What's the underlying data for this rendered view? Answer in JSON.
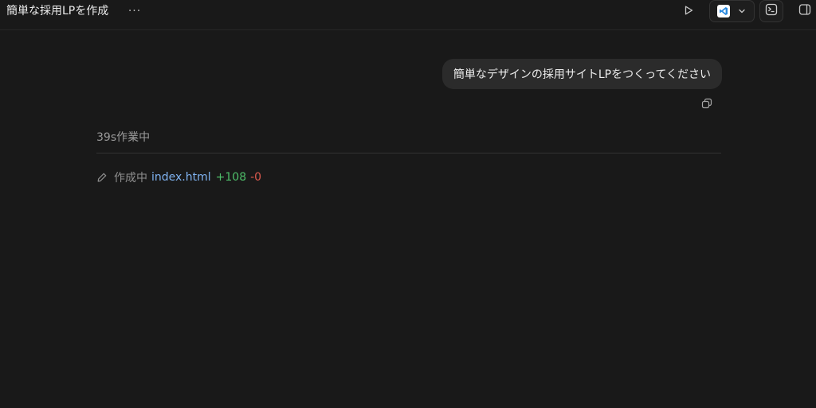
{
  "header": {
    "title": "簡単な採用LPを作成",
    "more_label": "···",
    "run_icon": "play-icon",
    "editor_icon": "vscode-icon",
    "terminal_icon": "terminal-icon",
    "panel_icon": "sidebar-panel-icon"
  },
  "chat": {
    "user_message": "簡単なデザインの採用サイトLPをつくってください",
    "copy_icon": "copy-icon",
    "work_status": "39s作業中",
    "edit": {
      "icon": "pencil-icon",
      "label": "作成中",
      "file": "index.html",
      "added": "+108",
      "removed": "-0"
    }
  },
  "colors": {
    "background": "#191919",
    "bubble": "#2b2b2b",
    "link": "#7fb2f0",
    "added": "#4fbf6a",
    "removed": "#e05a4f",
    "vscode_blue": "#2a8ae0"
  }
}
